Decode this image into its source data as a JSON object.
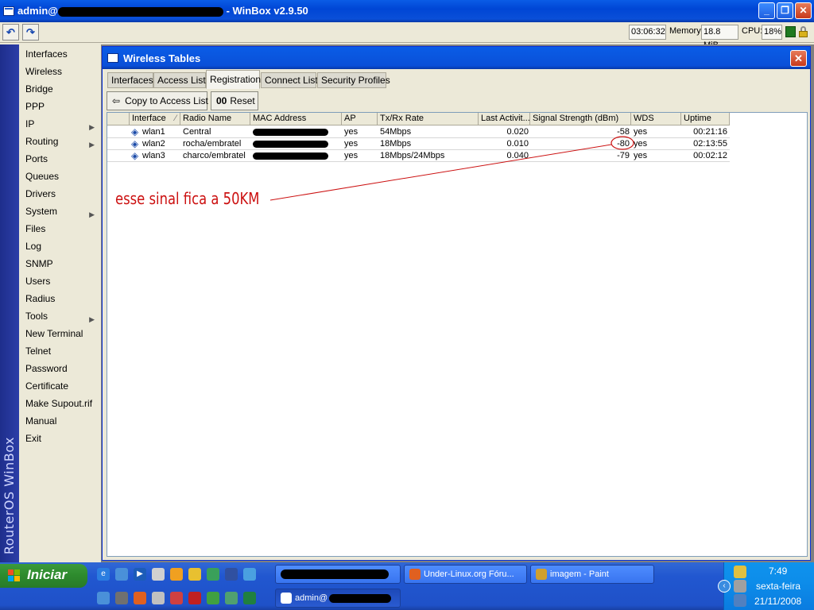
{
  "app": {
    "title_prefix": "admin@",
    "title_suffix": " - WinBox v2.9.50"
  },
  "toolbar": {
    "undo_icon": "undo-icon",
    "redo_icon": "redo-icon",
    "time": "03:06:32",
    "memory_label": "Memory:",
    "memory_value": "18.8 MiB",
    "cpu_label": "CPU:",
    "cpu_value": "18%"
  },
  "brand": {
    "vertical_text": "RouterOS WinBox"
  },
  "sidebar": {
    "items": [
      {
        "label": "Interfaces",
        "submenu": false
      },
      {
        "label": "Wireless",
        "submenu": false
      },
      {
        "label": "Bridge",
        "submenu": false
      },
      {
        "label": "PPP",
        "submenu": false
      },
      {
        "label": "IP",
        "submenu": true
      },
      {
        "label": "Routing",
        "submenu": true
      },
      {
        "label": "Ports",
        "submenu": false
      },
      {
        "label": "Queues",
        "submenu": false
      },
      {
        "label": "Drivers",
        "submenu": false
      },
      {
        "label": "System",
        "submenu": true
      },
      {
        "label": "Files",
        "submenu": false
      },
      {
        "label": "Log",
        "submenu": false
      },
      {
        "label": "SNMP",
        "submenu": false
      },
      {
        "label": "Users",
        "submenu": false
      },
      {
        "label": "Radius",
        "submenu": false
      },
      {
        "label": "Tools",
        "submenu": true
      },
      {
        "label": "New Terminal",
        "submenu": false
      },
      {
        "label": "Telnet",
        "submenu": false
      },
      {
        "label": "Password",
        "submenu": false
      },
      {
        "label": "Certificate",
        "submenu": false
      },
      {
        "label": "Make Supout.rif",
        "submenu": false
      },
      {
        "label": "Manual",
        "submenu": false
      },
      {
        "label": "Exit",
        "submenu": false
      }
    ]
  },
  "window": {
    "title": "Wireless Tables",
    "tabs": [
      "Interfaces",
      "Access List",
      "Registration",
      "Connect List",
      "Security Profiles"
    ],
    "active_tab": "Registration",
    "copy_button": "Copy to Access List",
    "reset_icon_text": "00",
    "reset_button": "Reset"
  },
  "table": {
    "columns": [
      "Interface",
      "Radio Name",
      "MAC Address",
      "AP",
      "Tx/Rx Rate",
      "Last Activit...",
      "Signal Strength (dBm)",
      "WDS",
      "Uptime"
    ],
    "rows": [
      {
        "interface": "wlan1",
        "radio_name": "Central",
        "ap": "yes",
        "rate": "54Mbps",
        "last_activity": "0.020",
        "signal": "-58",
        "wds": "yes",
        "uptime": "00:21:16"
      },
      {
        "interface": "wlan2",
        "radio_name": "rocha/embratel",
        "ap": "yes",
        "rate": "18Mbps",
        "last_activity": "0.010",
        "signal": "-80",
        "wds": "yes",
        "uptime": "02:13:55"
      },
      {
        "interface": "wlan3",
        "radio_name": "charco/embratel",
        "ap": "yes",
        "rate": "18Mbps/24Mbps",
        "last_activity": "0.040",
        "signal": "-79",
        "wds": "yes",
        "uptime": "00:02:12"
      }
    ],
    "annotation": "esse sinal fica a 50KM",
    "annotation_color": "#cc1111"
  },
  "taskbar": {
    "start_label": "Iniciar",
    "tasks": [
      {
        "label": "Under-Linux.org Fóru...",
        "icon": "firefox-icon"
      },
      {
        "label": "imagem - Paint",
        "icon": "paint-icon"
      },
      {
        "label": "admin@",
        "icon": "winbox-icon"
      }
    ],
    "clock": {
      "time": "7:49",
      "day": "sexta-feira",
      "date": "21/11/2008"
    }
  },
  "colors": {
    "titlebar_blue": "#0a4fd8",
    "sidebar_band": "#2c3ea8",
    "taskbar_blue": "#2157d0",
    "start_green": "#2d8a2d"
  }
}
